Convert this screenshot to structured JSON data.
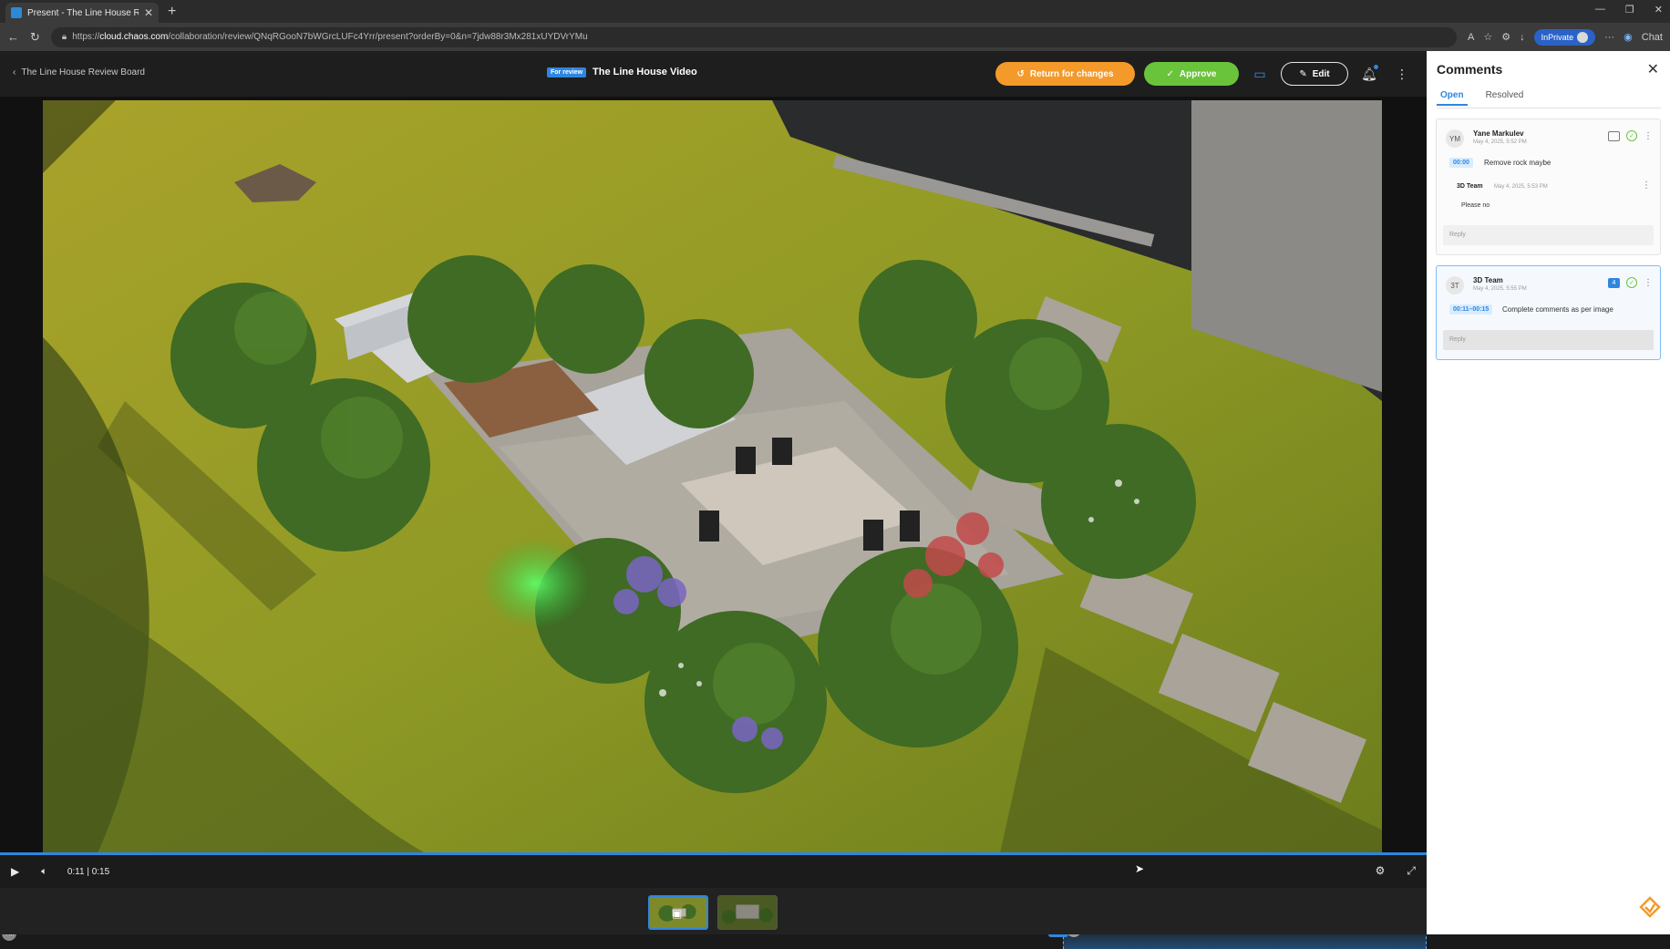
{
  "browser": {
    "tab_title": "Present - The Line House Review B",
    "url_prefix": "https://",
    "url_domain": "cloud.chaos.com",
    "url_path": "/collaboration/review/QNqRGooN7bWGrcLUFc4Yrr/present?orderBy=0&n=7jdw88r3Mx281xUYDVrYMu",
    "inprivate_label": "InPrivate",
    "chat_label": "Chat"
  },
  "header": {
    "back_label": "The Line House Review Board",
    "status_badge": "For review",
    "video_title": "The Line House Video",
    "return_label": "Return for changes",
    "approve_label": "Approve",
    "edit_label": "Edit"
  },
  "player": {
    "time_display": "0:11 | 0:15",
    "progress": 1.0,
    "marker_count": "4",
    "marker_avatar": "3T",
    "viewer_avatar": "YM"
  },
  "comments": {
    "title": "Comments",
    "tabs": [
      "Open",
      "Resolved"
    ],
    "active_tab": "Open",
    "threads": [
      {
        "initials": "YM",
        "author": "Yane Markulev",
        "date": "May 4, 2025, 5:52 PM",
        "timestamp": "00:00",
        "text": "Remove rock maybe",
        "reply": {
          "author": "3D Team",
          "date": "May 4, 2025, 5:53 PM",
          "text": "Please no"
        },
        "reply_placeholder": "Reply"
      },
      {
        "initials": "3T",
        "author": "3D Team",
        "date": "May 4, 2025, 5:55 PM",
        "timestamp": "00:11–00:15",
        "text": "Complete comments as per image",
        "pin_number": "4",
        "reply_placeholder": "Reply"
      }
    ]
  },
  "colors": {
    "accent": "#2f86e0",
    "return": "#f39a2b",
    "approve": "#6ac43b"
  }
}
